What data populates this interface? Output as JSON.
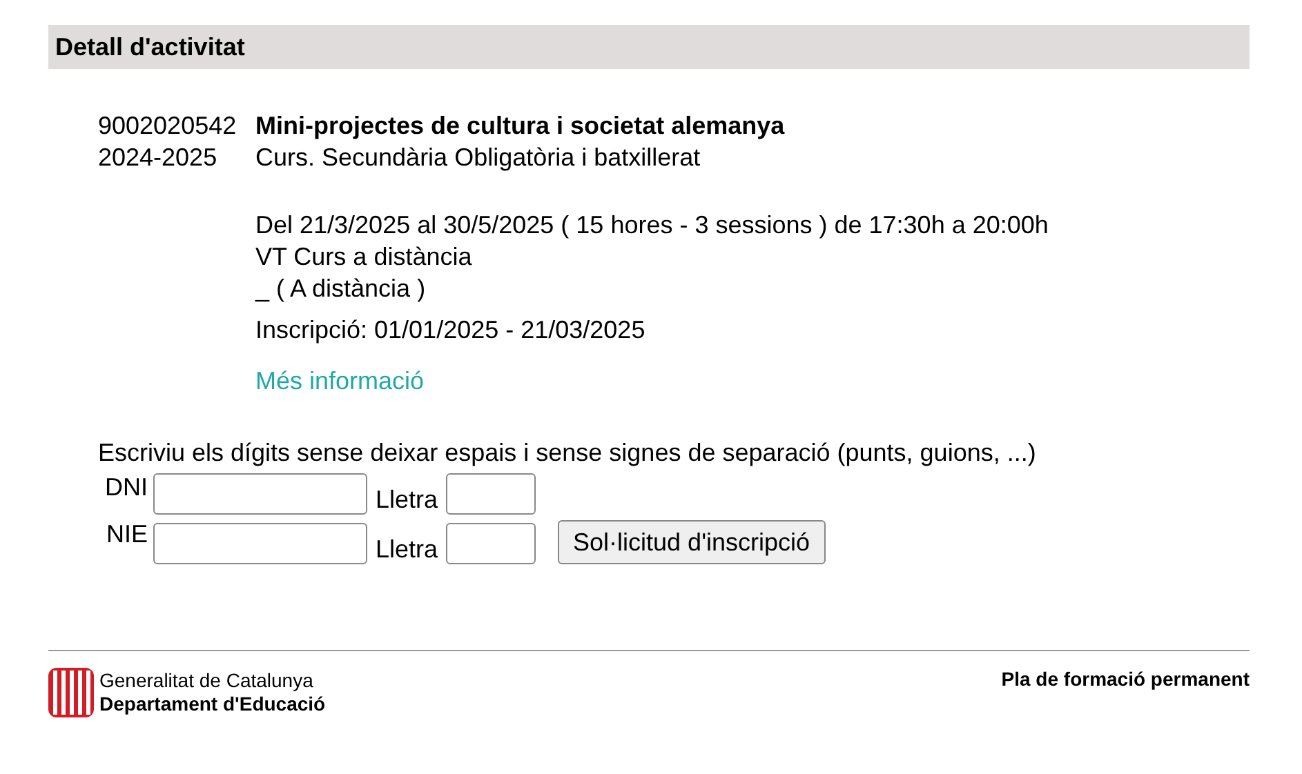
{
  "header": {
    "title": "Detall d'activitat"
  },
  "activity": {
    "code": "9002020542",
    "title": "Mini-projectes de cultura i societat alemanya",
    "year": "2024-2025",
    "type": "Curs. Secundària Obligatòria i batxillerat",
    "details": [
      "Del 21/3/2025 al 30/5/2025 ( 15 hores - 3 sessions ) de 17:30h a 20:00h",
      "VT Curs a distància",
      "_ ( A distància )"
    ],
    "registration": "Inscripció: 01/01/2025 - 21/03/2025",
    "link": "Més informació"
  },
  "form": {
    "instruction": "Escriviu els dígits sense deixar espais i sense signes de separació (punts, guions, ...)",
    "rows": [
      {
        "label": "DNI",
        "letter_label": "Lletra"
      },
      {
        "label": "NIE",
        "letter_label": "Lletra"
      }
    ],
    "button": "Sol·licitud d'inscripció"
  },
  "footer": {
    "org": "Generalitat de Catalunya",
    "department": "Departament d'Educació",
    "program": "Pla de formació permanent"
  }
}
